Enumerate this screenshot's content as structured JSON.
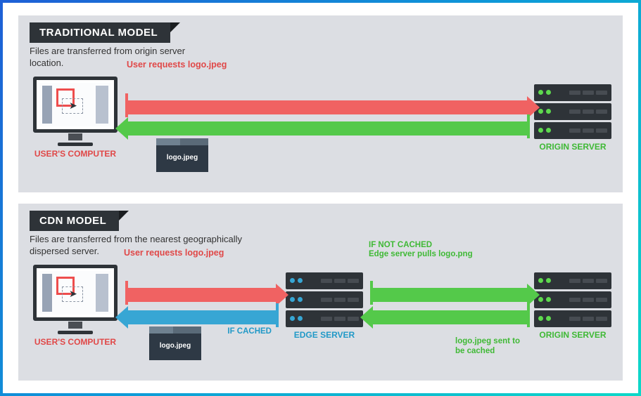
{
  "traditional": {
    "title": "TRADITIONAL MODEL",
    "description": "Files are transferred from origin server location.",
    "user_label": "USER'S COMPUTER",
    "origin_label": "ORIGIN SERVER",
    "request_label": "User requests logo.jpeg",
    "file_name": "logo.jpeg"
  },
  "cdn": {
    "title": "CDN MODEL",
    "description": "Files are transferred from the nearest geographically dispersed server.",
    "user_label": "USER'S COMPUTER",
    "edge_label": "EDGE SERVER",
    "origin_label": "ORIGIN SERVER",
    "request_label": "User requests logo.jpeg",
    "cached_label": "IF CACHED",
    "not_cached_heading": "IF NOT CACHED",
    "not_cached_sub": "Edge server pulls logo.png",
    "sent_back": "logo.jpeg sent to be cached",
    "file_name": "logo.jpeg"
  }
}
